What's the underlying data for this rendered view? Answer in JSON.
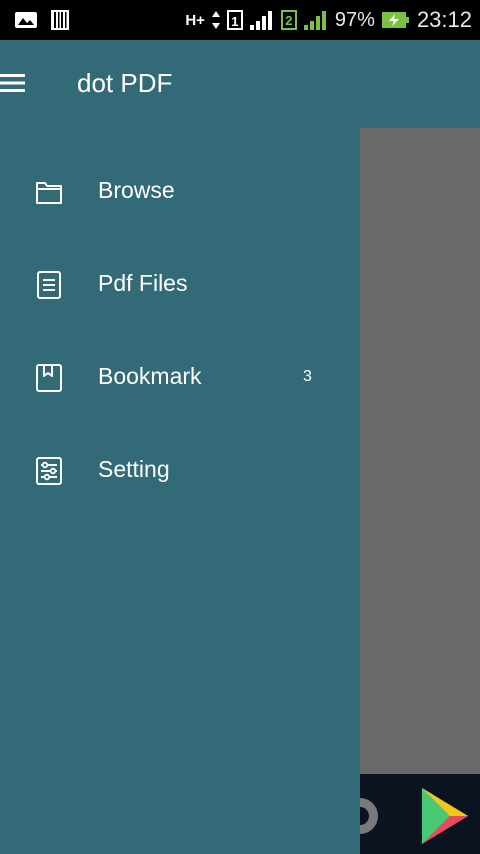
{
  "status_bar": {
    "network": "H+",
    "sim1": "1",
    "sim2": "2",
    "battery_percent": "97%",
    "time": "23:12",
    "battery_color": "#7cc242"
  },
  "drawer": {
    "app_title": "dot PDF",
    "menu_icon": "hamburger-menu-icon",
    "items": [
      {
        "label": "Browse",
        "icon": "folder-icon",
        "count": ""
      },
      {
        "label": "Pdf Files",
        "icon": "document-icon",
        "count": ""
      },
      {
        "label": "Bookmark",
        "icon": "bookmark-icon",
        "count": "3"
      },
      {
        "label": "Setting",
        "icon": "settings-sliders-icon",
        "count": ""
      }
    ]
  },
  "colors": {
    "drawer_bg": "#326b77",
    "scrim_gray": "#6a6a6a",
    "bottom_bar": "#0b1320"
  }
}
